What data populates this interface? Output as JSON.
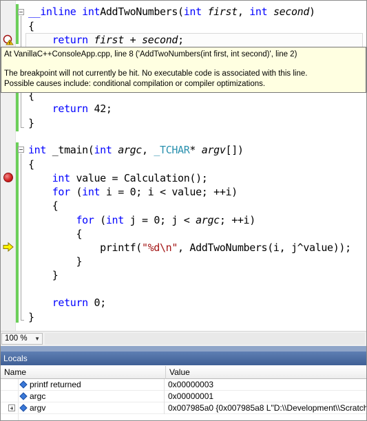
{
  "editor": {
    "lines": [
      {
        "id": "fn1-sig",
        "parts": [
          [
            "kw",
            "__inline "
          ],
          [
            "kw",
            "int"
          ],
          [
            "",
            "AddTwoNumbers("
          ],
          [
            "kw",
            "int"
          ],
          [
            "it",
            " first"
          ],
          [
            "",
            ", "
          ],
          [
            "kw",
            "int"
          ],
          [
            "it",
            " second"
          ],
          [
            "",
            ")"
          ]
        ]
      },
      {
        "id": "fn1-open",
        "parts": [
          [
            "",
            "{"
          ]
        ]
      },
      {
        "id": "fn1-return",
        "parts": [
          [
            "",
            "    "
          ],
          [
            "kw",
            "return"
          ],
          [
            "it",
            " first"
          ],
          [
            "",
            " + "
          ],
          [
            "it",
            "second"
          ],
          [
            "",
            ";"
          ]
        ]
      },
      {
        "id": "fn2-open",
        "parts": [
          [
            "",
            "{"
          ]
        ]
      },
      {
        "id": "fn2-return",
        "parts": [
          [
            "",
            "    "
          ],
          [
            "kw",
            "return"
          ],
          [
            "",
            " 42;"
          ]
        ]
      },
      {
        "id": "fn2-close",
        "parts": [
          [
            "",
            "}"
          ]
        ]
      },
      {
        "id": "main-sig",
        "parts": [
          [
            "kw",
            "int"
          ],
          [
            "",
            " _tmain("
          ],
          [
            "kw",
            "int"
          ],
          [
            "it",
            " argc"
          ],
          [
            "",
            ", "
          ],
          [
            "ty",
            "_TCHAR"
          ],
          [
            "",
            "* "
          ],
          [
            "it",
            "argv"
          ],
          [
            "",
            "[])"
          ]
        ]
      },
      {
        "id": "main-open",
        "parts": [
          [
            "",
            "{"
          ]
        ]
      },
      {
        "id": "main-value",
        "parts": [
          [
            "",
            "    "
          ],
          [
            "kw",
            "int"
          ],
          [
            "",
            " value = Calculation();"
          ]
        ]
      },
      {
        "id": "main-for-i",
        "parts": [
          [
            "",
            "    "
          ],
          [
            "kw",
            "for"
          ],
          [
            "",
            " ("
          ],
          [
            "kw",
            "int"
          ],
          [
            "",
            " i = 0; i < value; ++i)"
          ]
        ]
      },
      {
        "id": "main-open-i",
        "parts": [
          [
            "",
            "    {"
          ]
        ]
      },
      {
        "id": "main-for-j",
        "parts": [
          [
            "",
            "        "
          ],
          [
            "kw",
            "for"
          ],
          [
            "",
            " ("
          ],
          [
            "kw",
            "int"
          ],
          [
            "",
            " j = 0; j < "
          ],
          [
            "it",
            "argc"
          ],
          [
            "",
            "; ++i)"
          ]
        ]
      },
      {
        "id": "main-open-j",
        "parts": [
          [
            "",
            "        {"
          ]
        ]
      },
      {
        "id": "main-printf",
        "parts": [
          [
            "",
            "            printf("
          ],
          [
            "str",
            "\"%d\\n\""
          ],
          [
            "",
            ", AddTwoNumbers(i, j^value));"
          ]
        ]
      },
      {
        "id": "main-close-j",
        "parts": [
          [
            "",
            "        }"
          ]
        ]
      },
      {
        "id": "main-close-i",
        "parts": [
          [
            "",
            "    }"
          ]
        ]
      },
      {
        "id": "main-return",
        "parts": [
          [
            "",
            "    "
          ],
          [
            "kw",
            "return"
          ],
          [
            "",
            " 0;"
          ]
        ]
      },
      {
        "id": "main-close",
        "parts": [
          [
            "",
            "}"
          ]
        ]
      }
    ]
  },
  "tooltip": {
    "line1": "At VanillaC++ConsoleApp.cpp, line 8 ('AddTwoNumbers(int first, int second)', line 2)",
    "line2": "The breakpoint will not currently be hit. No executable code is associated with this line.",
    "line3": "Possible causes include: conditional compilation or compiler optimizations."
  },
  "zoom": {
    "value": "100 %"
  },
  "locals": {
    "title": "Locals",
    "columns": [
      "Name",
      "Value"
    ],
    "rows": [
      {
        "name": "printf returned",
        "value": "0x00000003",
        "expandable": false
      },
      {
        "name": "argc",
        "value": "0x00000001",
        "expandable": false
      },
      {
        "name": "argv",
        "value": "0x007985a0 {0x007985a8 L\"D:\\\\Development\\\\Scratch",
        "expandable": true
      }
    ]
  },
  "colors": {
    "keyword": "#0000ff",
    "type": "#2b91af",
    "string": "#a31515",
    "change_bar": "#6ccf5a",
    "tooltip_bg": "#ffffe1",
    "panel_title": "#4a6aa0"
  },
  "icons": [
    "breakpoint-warning-icon",
    "breakpoint-icon",
    "current-statement-arrow-icon",
    "collapse-icon",
    "expand-icon",
    "variable-icon"
  ]
}
